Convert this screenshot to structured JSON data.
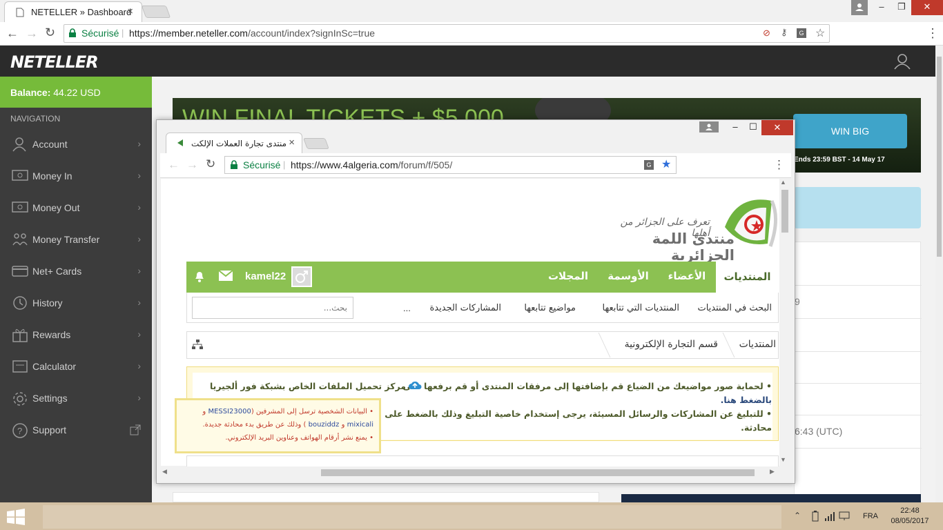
{
  "browser": {
    "tab_title": "NETELLER » Dashboard",
    "secure_label": "Sécurisé",
    "url_host": "https://member.neteller.com",
    "url_path": "/account/index?signInSc=true"
  },
  "neteller": {
    "logo": "NETELLER",
    "balance_label": "Balance:",
    "balance_value": "44.22 USD",
    "nav_heading": "NAVIGATION",
    "nav_items": [
      {
        "label": "Account",
        "icon": "user-icon"
      },
      {
        "label": "Money In",
        "icon": "money-in-icon"
      },
      {
        "label": "Money Out",
        "icon": "money-out-icon"
      },
      {
        "label": "Money Transfer",
        "icon": "transfer-icon"
      },
      {
        "label": "Net+ Cards",
        "icon": "card-icon"
      },
      {
        "label": "History",
        "icon": "history-icon"
      },
      {
        "label": "Rewards",
        "icon": "gift-icon"
      },
      {
        "label": "Calculator",
        "icon": "calculator-icon"
      },
      {
        "label": "Settings",
        "icon": "gear-icon"
      },
      {
        "label": "Support",
        "icon": "help-icon"
      }
    ],
    "banner_text": "WIN FINAL TICKETS + $5,000",
    "win_big": "WIN BIG",
    "ends_text": "Ends 23:59 BST - 14 May 17",
    "partial_nine": "9",
    "partial_time": "6:43 (UTC)"
  },
  "popup": {
    "tab_title": "منتدى تجارة العملات الإلكت",
    "secure_label": "Sécurisé",
    "url_host": "https://www.4algeria.com",
    "url_path": "/forum/f/505/",
    "logo_tagline": "تعرف على الجزائر من أهلها",
    "logo_title": "منتدى اللمة الجزائرية",
    "main_nav": [
      "المنتديات",
      "الأعضاء",
      "الأوسمة",
      "المجلات"
    ],
    "username": "kamel22",
    "sub_nav": [
      "البحث في المنتديات",
      "المنتديات التي تتابعها",
      "مواضيع تتابعها",
      "المشاركات الجديدة",
      "..."
    ],
    "search_placeholder": "بحث...",
    "breadcrumb": [
      "المنتديات",
      "قسم التجارة الإلكترونية"
    ],
    "notice_1": "• لحماية صور مواضيعك من الضياع قم بإضافتها إلى مرفقات المنتدى أو قم برفعها على",
    "notice_1b": "مركز تحميل الملفات الخاص بشبكة فور ألجيريا",
    "notice_1c": "بالضغط هنا.",
    "notice_2": "• للتبليغ عن المشاركات والرسائل المسيئة، يرجى إستخدام خاصية التبليغ وذلك بالضغط على أيقونة",
    "notice_2b": "محادثة.",
    "tooltip_1a": "• البيانات الشخصية ترسل إلى المشرفين (",
    "tooltip_1_name1": "MESSI23000",
    "tooltip_1b": " و ",
    "tooltip_2_name2": "mixicali",
    "tooltip_2a": " و ",
    "tooltip_2_name3": "bouziddz",
    "tooltip_2b": " ) وذلك عن طريق بدء محادثة جديدة.",
    "tooltip_3": "• يمنع نشر أرقام الهواتف وعناوين البريد الإلكتروني."
  },
  "taskbar": {
    "lang": "FRA",
    "time": "22:48",
    "date": "08/05/2017"
  },
  "colors": {
    "neteller_green": "#76bb3a",
    "forum_green": "#8cc152",
    "sidebar_bg": "#3c3c3c",
    "accent_blue": "#3fa4c9"
  }
}
